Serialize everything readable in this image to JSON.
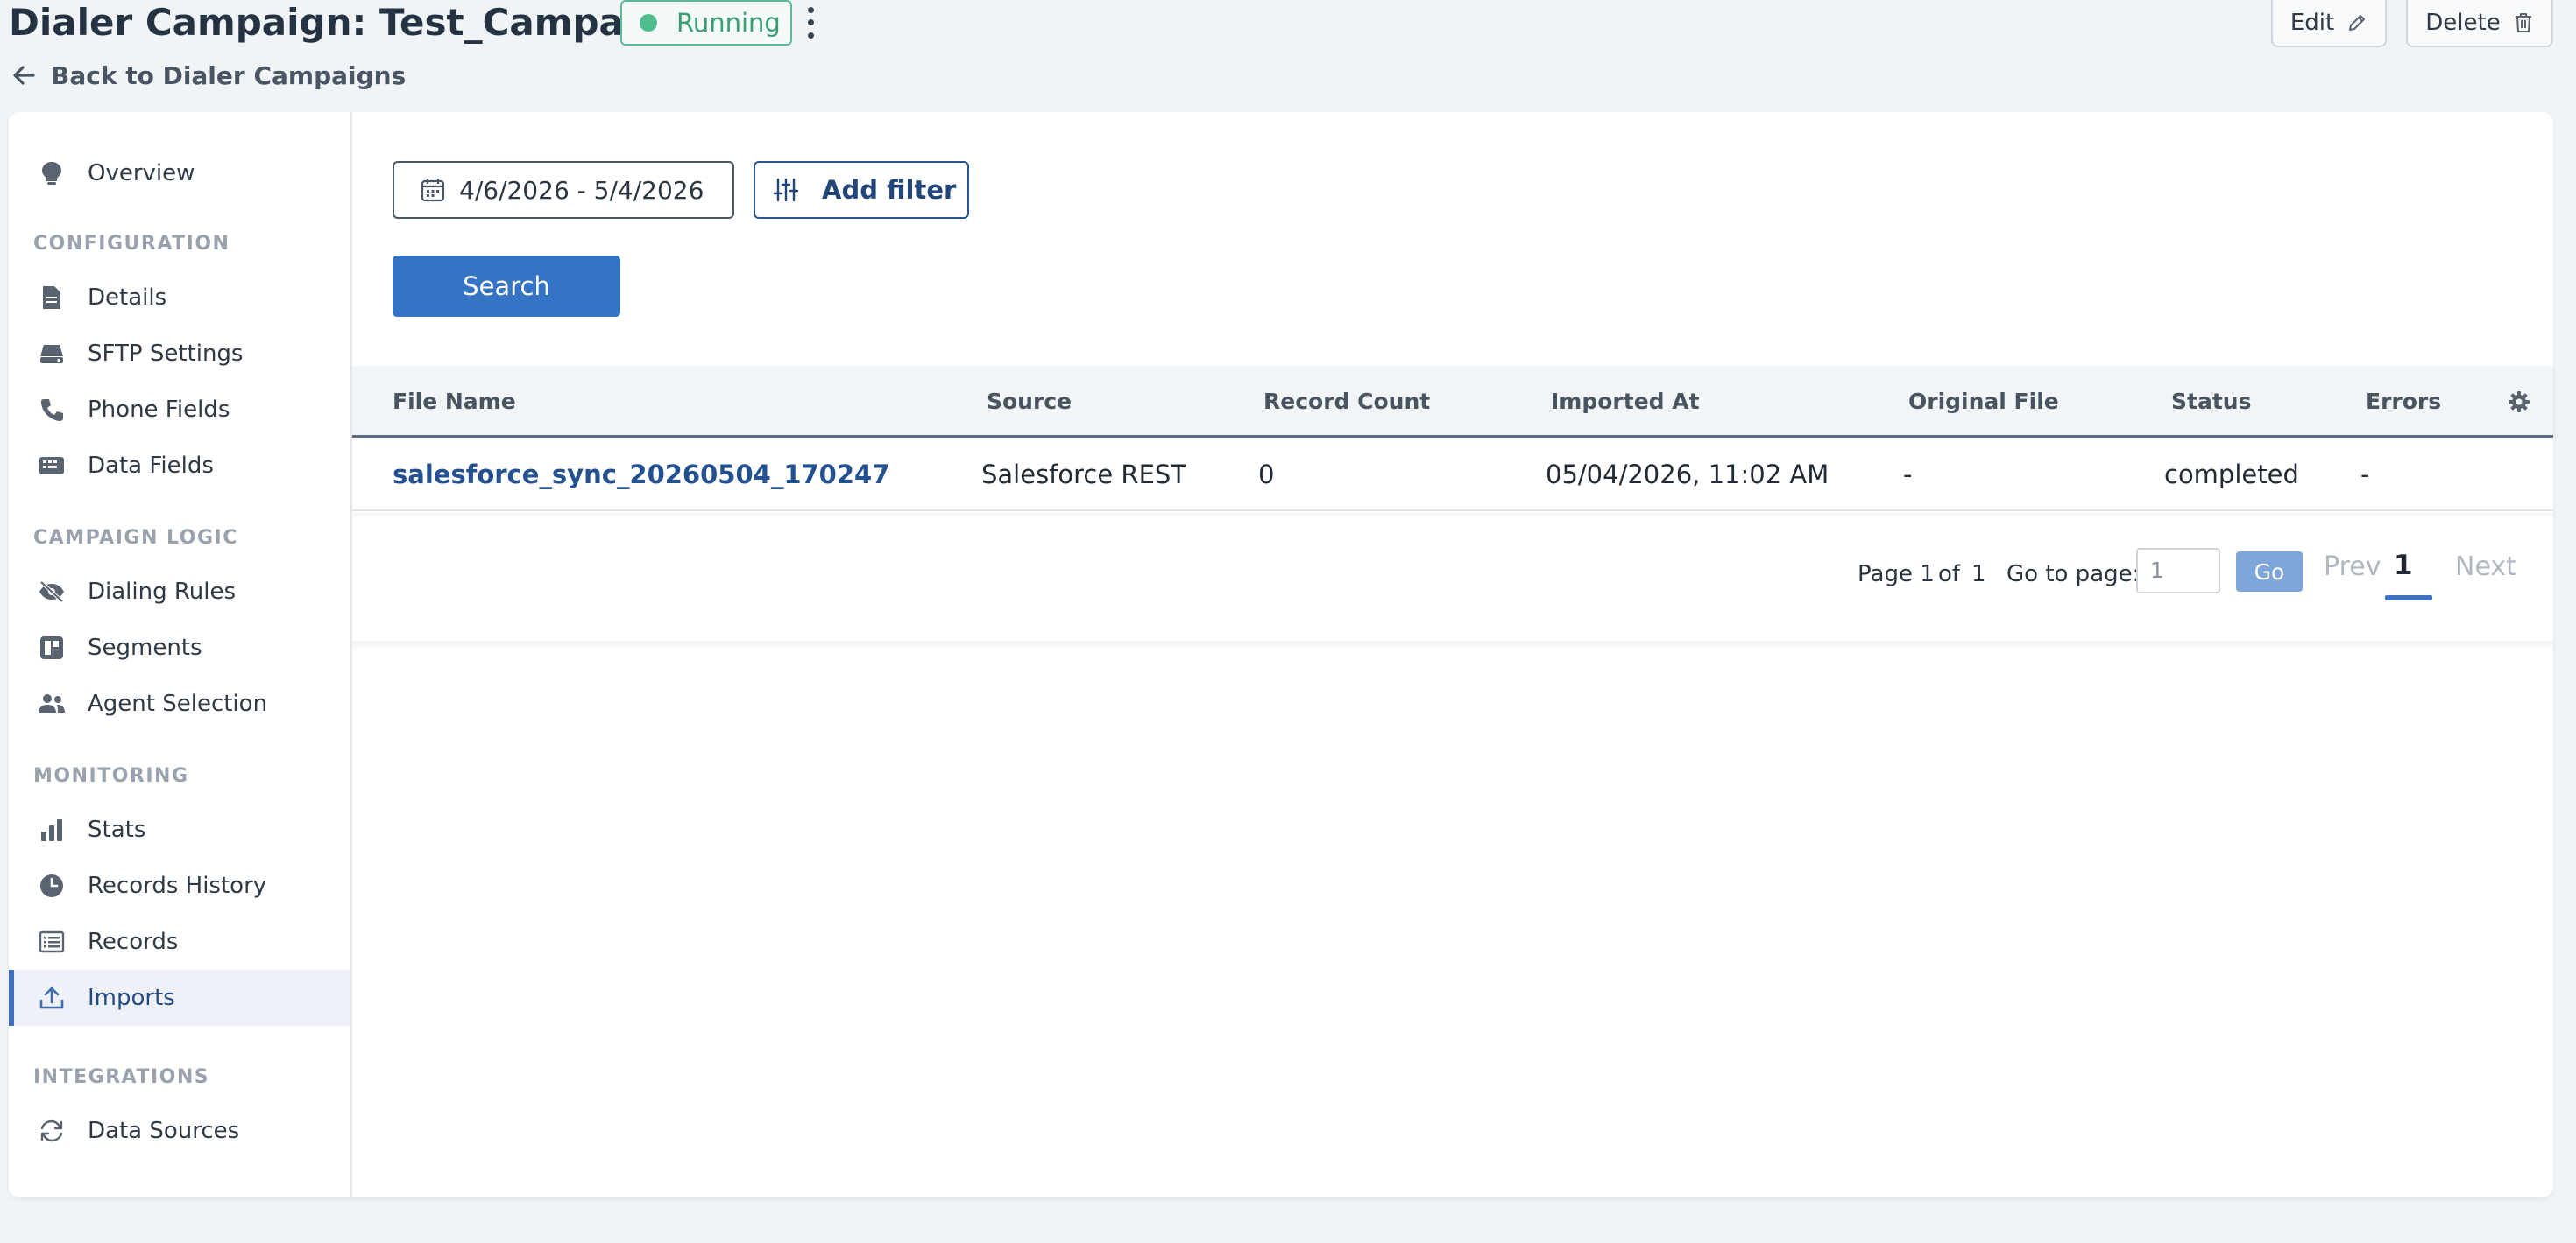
{
  "header": {
    "title": "Dialer Campaign: Test_Campaign",
    "status": "Running",
    "back_label": "Back to Dialer Campaigns",
    "edit_label": "Edit",
    "delete_label": "Delete"
  },
  "sidebar": {
    "overview": "Overview",
    "sections": {
      "configuration": "CONFIGURATION",
      "campaign_logic": "CAMPAIGN LOGIC",
      "monitoring": "MONITORING",
      "integrations": "INTEGRATIONS"
    },
    "items": {
      "details": "Details",
      "sftp": "SFTP Settings",
      "phone_fields": "Phone Fields",
      "data_fields": "Data Fields",
      "dialing_rules": "Dialing Rules",
      "segments": "Segments",
      "agent_selection": "Agent Selection",
      "stats": "Stats",
      "records_history": "Records History",
      "records": "Records",
      "imports": "Imports",
      "data_sources": "Data Sources"
    },
    "active": "imports"
  },
  "filters": {
    "date_range": "4/6/2026 - 5/4/2026",
    "add_filter": "Add filter",
    "search": "Search"
  },
  "table": {
    "columns": {
      "file_name": "File Name",
      "source": "Source",
      "record_count": "Record Count",
      "imported_at": "Imported At",
      "original_file": "Original File",
      "status": "Status",
      "errors": "Errors"
    },
    "rows": [
      {
        "file_name": "salesforce_sync_20260504_170247",
        "source": "Salesforce REST",
        "record_count": "0",
        "imported_at": "05/04/2026, 11:02 AM",
        "original_file": "-",
        "status": "completed",
        "errors": "-"
      }
    ]
  },
  "pagination": {
    "page_label": "Page 1",
    "of_label": "of",
    "total_pages": "1",
    "goto_label": "Go to page:",
    "goto_value": "1",
    "go": "Go",
    "prev": "Prev",
    "current": "1",
    "next": "Next"
  },
  "colors": {
    "accent": "#3573c4",
    "status_green": "#4fbd8d",
    "link": "#23508f"
  }
}
